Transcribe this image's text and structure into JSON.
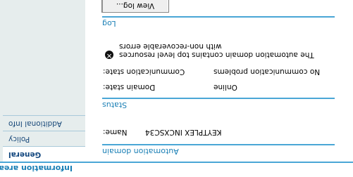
{
  "panel": {
    "title": "Information area"
  },
  "sidebar": {
    "items": [
      {
        "label": "General",
        "active": true
      },
      {
        "label": "Policy",
        "active": false
      },
      {
        "label": "Additional Info",
        "active": false
      }
    ]
  },
  "automation_domain": {
    "heading": "Automation domain",
    "name_label": "Name:",
    "name_value": "KEYTPLEX INCXSC34"
  },
  "status": {
    "heading": "Status",
    "domain_state_label": "Domain state:",
    "domain_state_value": "Online",
    "comm_state_label": "Communication state:",
    "comm_state_value": "No communication problems",
    "messages": [
      "The automation domain contains top level resources",
      "with non-recoverable errors"
    ]
  },
  "log": {
    "heading": "Log",
    "view_button": "View log..."
  },
  "icons": {
    "error": "error-x-icon"
  },
  "colors": {
    "accent": "#4aa6d6",
    "link": "#1a7fb5",
    "sidebar_bg": "#e6eded"
  }
}
